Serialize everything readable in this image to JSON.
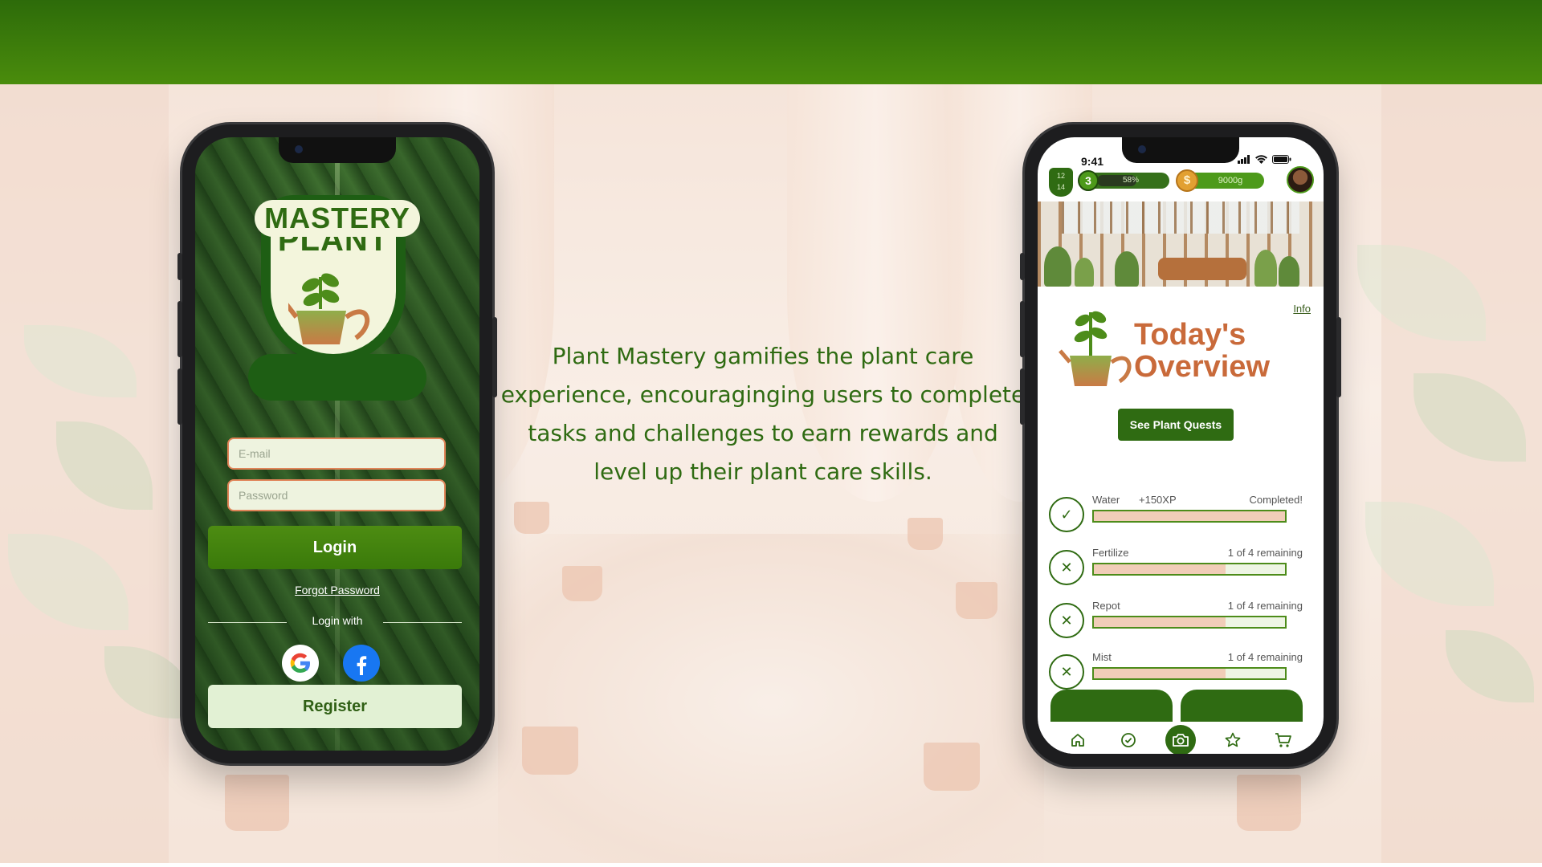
{
  "tagline": "Plant Mastery gamifies the plant care experience, encouraginging users to complete tasks and challenges to earn rewards and level up their plant care skills.",
  "login_screen": {
    "logo": {
      "top_text": "PLANT",
      "bottom_text": "MASTERY"
    },
    "email_placeholder": "E-mail",
    "password_placeholder": "Password",
    "login_label": "Login",
    "forgot_password_label": "Forgot Password",
    "login_with_label": "Login with",
    "social": [
      "google-icon",
      "facebook-icon"
    ],
    "register_label": "Register"
  },
  "overview_screen": {
    "status_time": "9:41",
    "level_badge": {
      "top": "12",
      "bottom": "14"
    },
    "xp": {
      "level": "3",
      "percent_label": "58%",
      "percent": 0.58
    },
    "gold": {
      "symbol": "$",
      "amount": "9000g"
    },
    "info_label": "Info",
    "title_line1": "Today's",
    "title_line2": "Overview",
    "quests_button_label": "See Plant Quests",
    "tasks": [
      {
        "name": "Water",
        "xp": "+150XP",
        "status": "Completed!",
        "done": true,
        "progress": 1.0
      },
      {
        "name": "Fertilize",
        "xp": "",
        "status": "1 of 4 remaining",
        "done": false,
        "progress": 0.69
      },
      {
        "name": "Repot",
        "xp": "",
        "status": "1 of 4 remaining",
        "done": false,
        "progress": 0.69
      },
      {
        "name": "Mist",
        "xp": "",
        "status": "1 of 4 remaining",
        "done": false,
        "progress": 0.69
      }
    ],
    "nav": [
      "home-icon",
      "check-circle-icon",
      "camera-icon",
      "star-icon",
      "cart-icon"
    ]
  },
  "colors": {
    "brand_green": "#2f6b12",
    "accent_orange": "#c96a3a",
    "top_bar": "#3a7a0a"
  }
}
